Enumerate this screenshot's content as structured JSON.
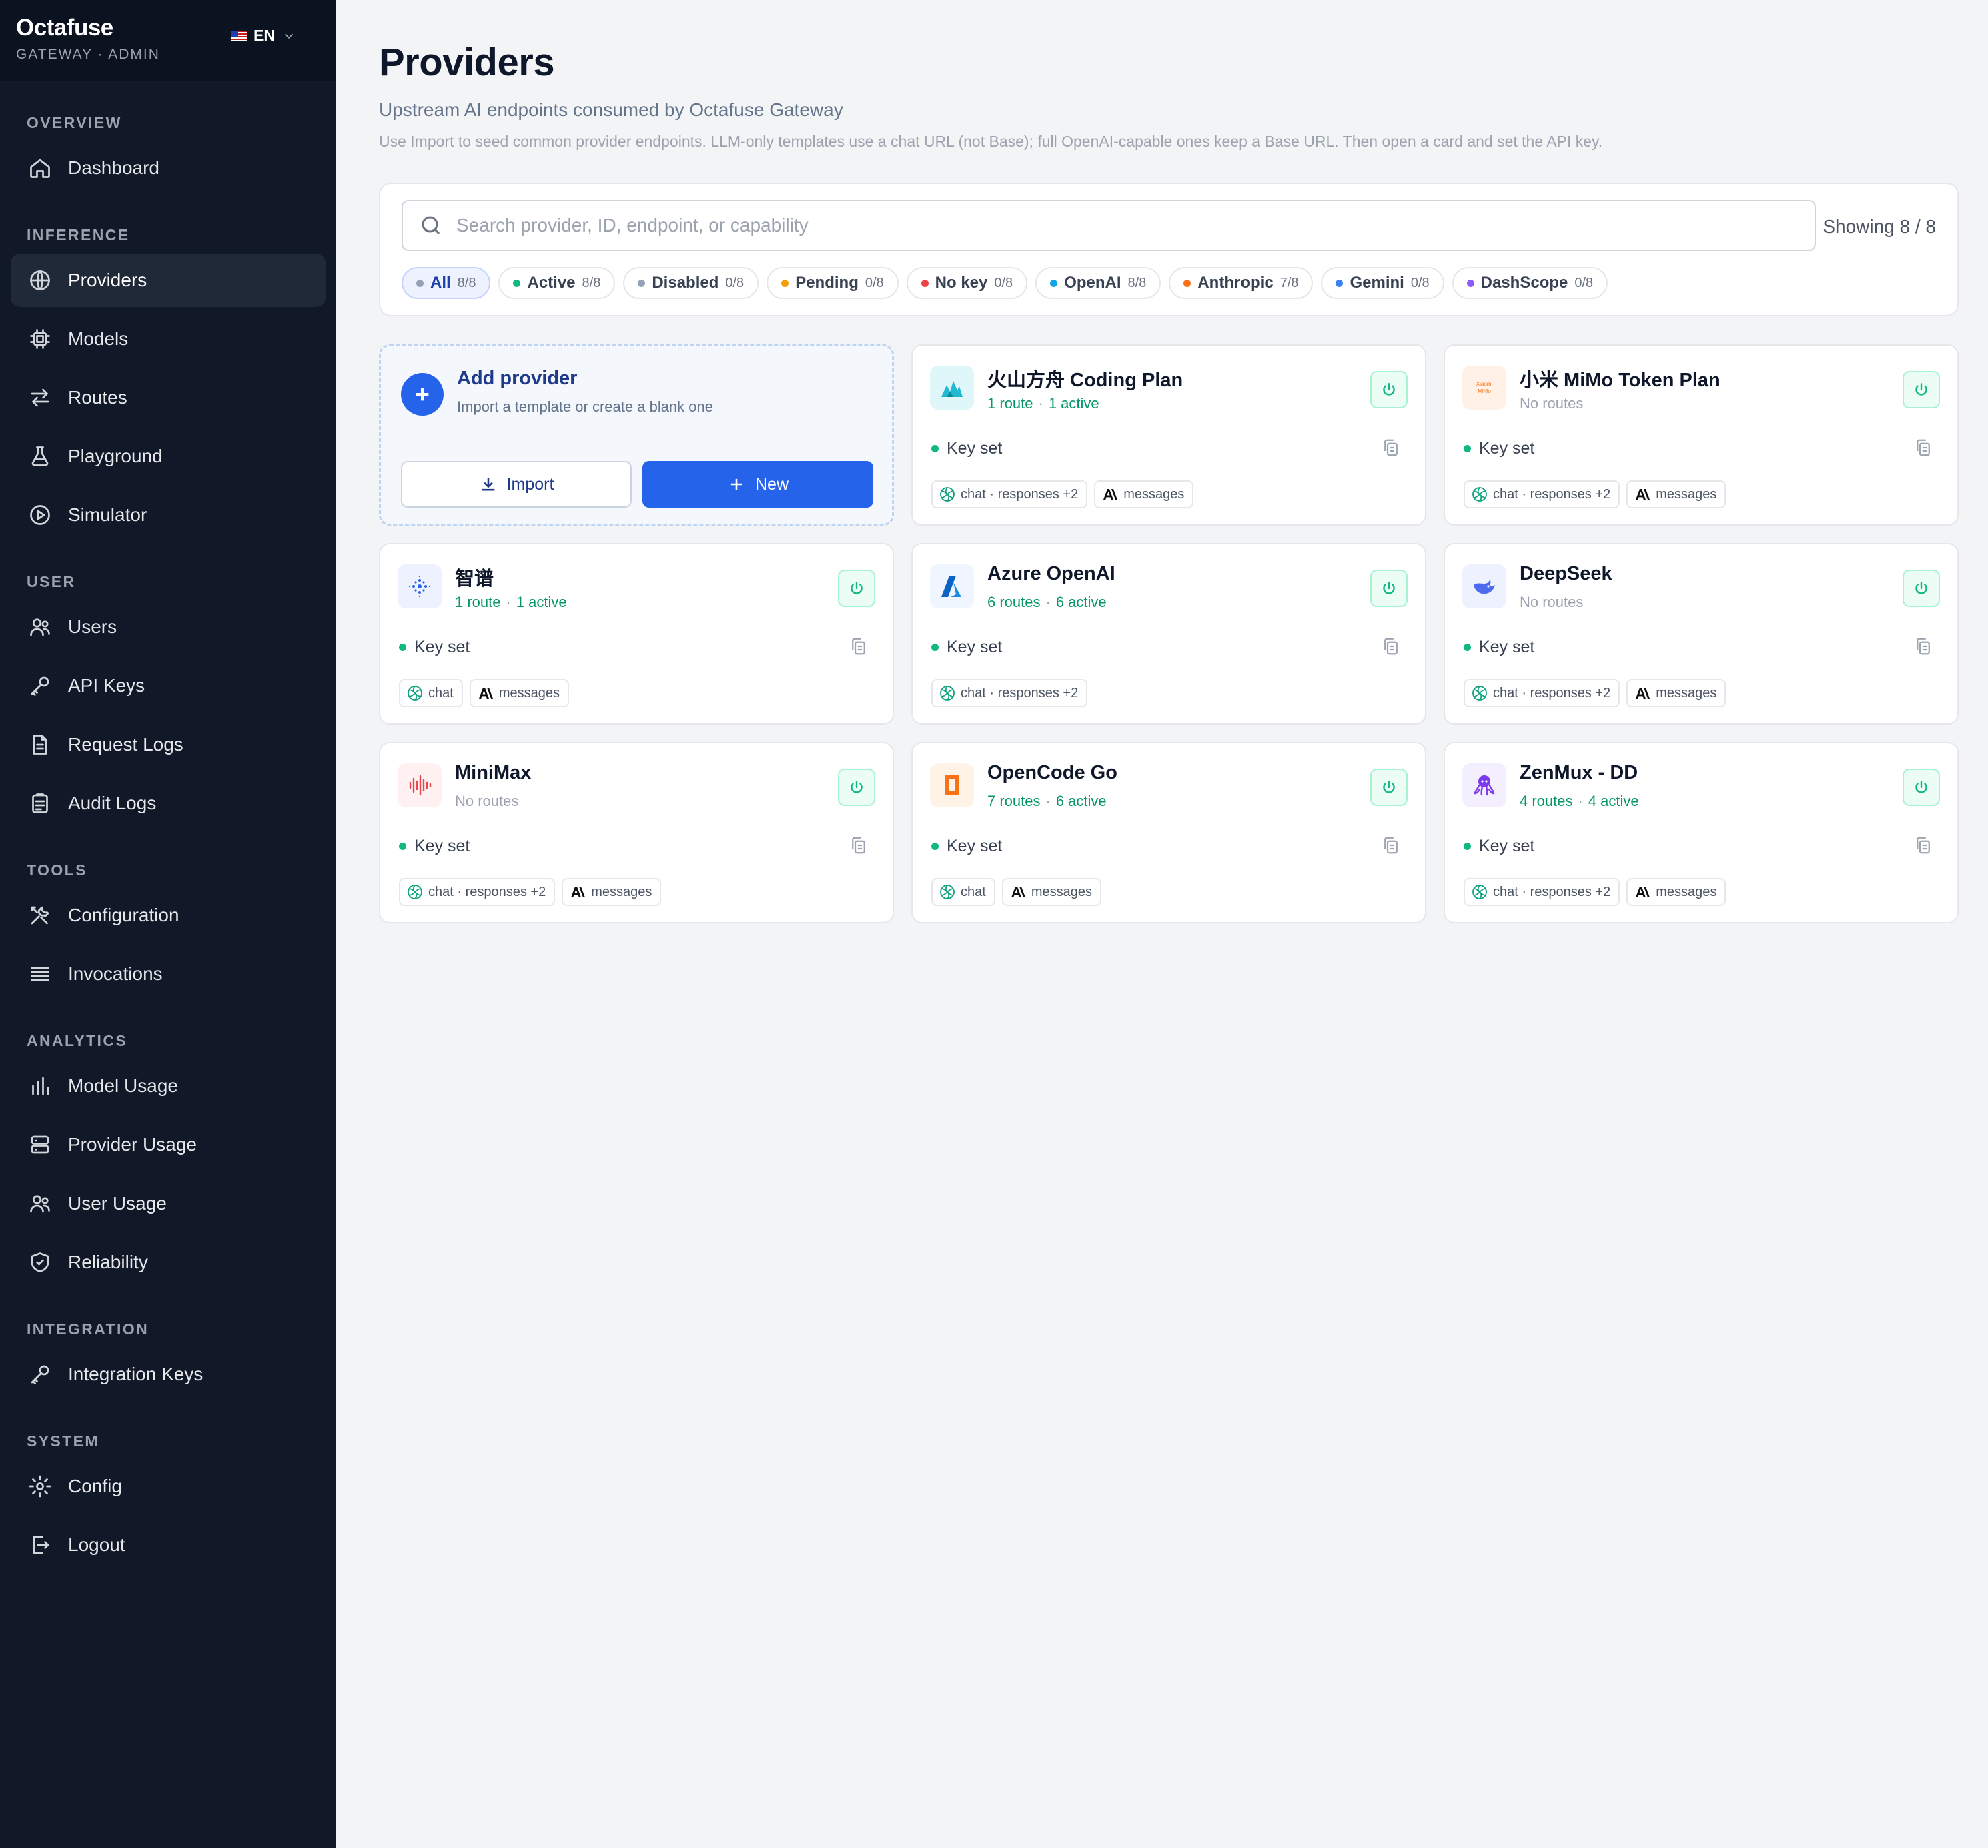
{
  "brand": {
    "name": "Octafuse",
    "subtitle": "GATEWAY · ADMIN",
    "language": "EN"
  },
  "nav": [
    {
      "title": "OVERVIEW",
      "items": [
        {
          "label": "Dashboard",
          "icon": "home-icon"
        }
      ]
    },
    {
      "title": "INFERENCE",
      "items": [
        {
          "label": "Providers",
          "icon": "globe-icon",
          "active": true
        },
        {
          "label": "Models",
          "icon": "chip-icon"
        },
        {
          "label": "Routes",
          "icon": "arrows-icon"
        },
        {
          "label": "Playground",
          "icon": "flask-icon"
        },
        {
          "label": "Simulator",
          "icon": "play-icon"
        }
      ]
    },
    {
      "title": "USER",
      "items": [
        {
          "label": "Users",
          "icon": "users-icon"
        },
        {
          "label": "API Keys",
          "icon": "key-icon"
        },
        {
          "label": "Request Logs",
          "icon": "document-icon"
        },
        {
          "label": "Audit Logs",
          "icon": "clipboard-icon"
        }
      ]
    },
    {
      "title": "TOOLS",
      "items": [
        {
          "label": "Configuration",
          "icon": "tools-icon"
        },
        {
          "label": "Invocations",
          "icon": "list-icon"
        }
      ]
    },
    {
      "title": "ANALYTICS",
      "items": [
        {
          "label": "Model Usage",
          "icon": "bar-chart-icon"
        },
        {
          "label": "Provider Usage",
          "icon": "server-icon"
        },
        {
          "label": "User Usage",
          "icon": "users-icon"
        },
        {
          "label": "Reliability",
          "icon": "shield-icon"
        }
      ]
    },
    {
      "title": "INTEGRATION",
      "items": [
        {
          "label": "Integration Keys",
          "icon": "key-icon"
        }
      ]
    },
    {
      "title": "SYSTEM",
      "items": [
        {
          "label": "Config",
          "icon": "gear-icon"
        },
        {
          "label": "Logout",
          "icon": "logout-icon"
        }
      ]
    }
  ],
  "page": {
    "title": "Providers",
    "subtitle": "Upstream AI endpoints consumed by Octafuse Gateway",
    "hint": "Use Import to seed common provider endpoints. LLM-only templates use a chat URL (not Base); full OpenAI-capable ones keep a Base URL. Then open a card and set the API key."
  },
  "search": {
    "placeholder": "Search provider, ID, endpoint, or capability",
    "value": "",
    "showing": "Showing 8 / 8"
  },
  "filters": [
    {
      "label": "All",
      "count": "8/8",
      "color": "#94a3b8",
      "active": true
    },
    {
      "label": "Active",
      "count": "8/8",
      "color": "#10b981"
    },
    {
      "label": "Disabled",
      "count": "0/8",
      "color": "#94a3b8"
    },
    {
      "label": "Pending",
      "count": "0/8",
      "color": "#f59e0b"
    },
    {
      "label": "No key",
      "count": "0/8",
      "color": "#ef4444"
    },
    {
      "label": "OpenAI",
      "count": "8/8",
      "color": "#0ea5e9"
    },
    {
      "label": "Anthropic",
      "count": "7/8",
      "color": "#f97316"
    },
    {
      "label": "Gemini",
      "count": "0/8",
      "color": "#3b82f6"
    },
    {
      "label": "DashScope",
      "count": "0/8",
      "color": "#8b5cf6"
    }
  ],
  "add_card": {
    "title": "Add provider",
    "subtitle": "Import a template or create a blank one",
    "import_label": "Import",
    "new_label": "New"
  },
  "providers": [
    {
      "name": "火山方舟 Coding Plan",
      "routes": "1 route",
      "active": "1 active",
      "logo": "volcano-icon",
      "logo_bg": "#e0f7fa",
      "key": "Key set",
      "tags": [
        {
          "icon": "openai-icon",
          "label": "chat · responses +2"
        },
        {
          "icon": "anthropic-icon",
          "label": "messages"
        }
      ]
    },
    {
      "name": "小米 MiMo Token Plan",
      "routes": "No routes",
      "active": "",
      "logo": "xiaomi-mimo-icon",
      "logo_text": "Xiaomi MiMo",
      "logo_bg": "#fff1e6",
      "key": "Key set",
      "tags": [
        {
          "icon": "openai-icon",
          "label": "chat · responses +2"
        },
        {
          "icon": "anthropic-icon",
          "label": "messages"
        }
      ]
    },
    {
      "name": "智谱",
      "routes": "1 route",
      "active": "1 active",
      "logo": "zhipu-icon",
      "logo_bg": "#eef2ff",
      "key": "Key set",
      "tags": [
        {
          "icon": "openai-icon",
          "label": "chat"
        },
        {
          "icon": "anthropic-icon",
          "label": "messages"
        }
      ]
    },
    {
      "name": "Azure OpenAI",
      "routes": "6 routes",
      "active": "6 active",
      "logo": "azure-icon",
      "logo_bg": "#eff6ff",
      "key": "Key set",
      "tags": [
        {
          "icon": "openai-icon",
          "label": "chat · responses +2"
        }
      ]
    },
    {
      "name": "DeepSeek",
      "routes": "No routes",
      "active": "",
      "logo": "deepseek-whale-icon",
      "logo_bg": "#eef2ff",
      "key": "Key set",
      "tags": [
        {
          "icon": "openai-icon",
          "label": "chat · responses +2"
        },
        {
          "icon": "anthropic-icon",
          "label": "messages"
        }
      ]
    },
    {
      "name": "MiniMax",
      "routes": "No routes",
      "active": "",
      "logo": "minimax-wave-icon",
      "logo_bg": "#fff1f2",
      "key": "Key set",
      "tags": [
        {
          "icon": "openai-icon",
          "label": "chat · responses +2"
        },
        {
          "icon": "anthropic-icon",
          "label": "messages"
        }
      ]
    },
    {
      "name": "OpenCode Go",
      "routes": "7 routes",
      "active": "6 active",
      "logo": "opencode-icon",
      "logo_bg": "#fff3e8",
      "key": "Key set",
      "tags": [
        {
          "icon": "openai-icon",
          "label": "chat"
        },
        {
          "icon": "anthropic-icon",
          "label": "messages"
        }
      ]
    },
    {
      "name": "ZenMux - DD",
      "routes": "4 routes",
      "active": "4 active",
      "logo": "octopus-icon",
      "logo_bg": "#f3efff",
      "key": "Key set",
      "tags": [
        {
          "icon": "openai-icon",
          "label": "chat · responses +2"
        },
        {
          "icon": "anthropic-icon",
          "label": "messages"
        }
      ]
    }
  ]
}
